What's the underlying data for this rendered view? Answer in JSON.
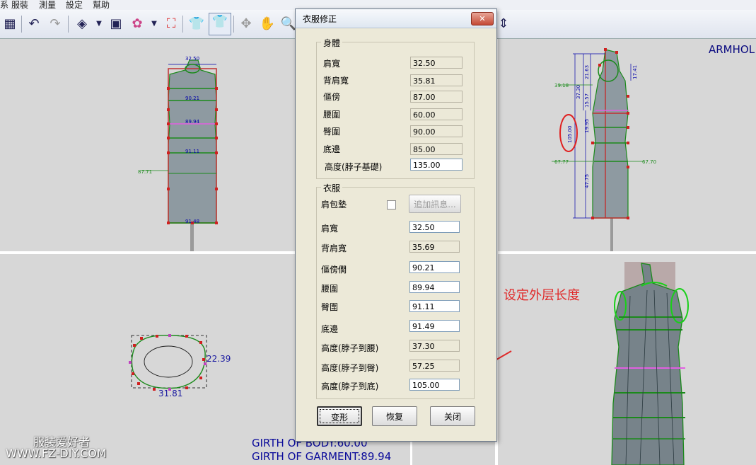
{
  "menu": [
    "系",
    "服裝",
    "測量",
    "設定",
    "幫助"
  ],
  "viewports": {
    "top_right_label": "ARMHOL",
    "front_view": {
      "shoulder": "32.50",
      "bust": "90.21",
      "waist": "89.94",
      "hip": "91.11",
      "hem": "91.48",
      "side_left": "87.71"
    },
    "side_view": {
      "left_measure": "39.18",
      "circled": "105.00",
      "v1": "37.30",
      "v2": "21.63",
      "v3": "15.57",
      "v4": "19.95",
      "v5": "47.75",
      "arm": "17.41",
      "left_bottom": "67.77",
      "right_bottom": "67.70"
    },
    "cross_section": {
      "right": "22.39",
      "bottom": "31.81"
    },
    "girth_body": "GIRTH OF BODY:60.00",
    "girth_garment": "GIRTH OF GARMENT:89.94",
    "watermark_line1": "服装爱好者",
    "watermark_line2": "WWW.FZ-DIY.COM",
    "annotation": "设定外层长度"
  },
  "dialog": {
    "title": "衣服修正",
    "close_label": "✕",
    "body_group": {
      "label": "身體",
      "rows": [
        {
          "label": "肩寬",
          "value": "32.50"
        },
        {
          "label": "背肩寬",
          "value": "35.81"
        },
        {
          "label": "傴傍",
          "value": "87.00"
        },
        {
          "label": "腰圍",
          "value": "60.00"
        },
        {
          "label": "臀圍",
          "value": "90.00"
        },
        {
          "label": "底邊",
          "value": "85.00"
        },
        {
          "label": "高度(脖子基礎)",
          "value": "135.00"
        }
      ]
    },
    "garment_group": {
      "label": "衣服",
      "shoulder_pad_label": "肩包墊",
      "more_info_button": "追加訊息...",
      "rows": [
        {
          "label": "肩寬",
          "value": "32.50"
        },
        {
          "label": "背肩寬",
          "value": "35.69"
        },
        {
          "label": "傴傍僩",
          "value": "90.21"
        },
        {
          "label": "腰圍",
          "value": "89.94"
        },
        {
          "label": "臀圍",
          "value": "91.11"
        },
        {
          "label": "底邊",
          "value": "91.49"
        },
        {
          "label": "高度(脖子到腰)",
          "value": "37.30"
        },
        {
          "label": "高度(脖子到臀)",
          "value": "57.25"
        },
        {
          "label": "高度(脖子到底)",
          "value": "105.00"
        }
      ]
    },
    "buttons": {
      "transform": "变形",
      "restore": "恢复",
      "close": "关闭"
    }
  }
}
